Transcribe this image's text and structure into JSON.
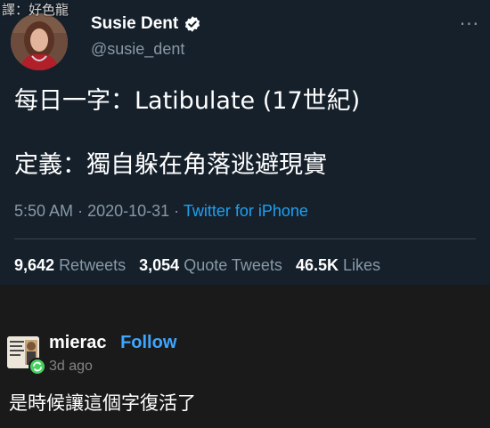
{
  "watermark": "譯：好色龍",
  "tweet": {
    "author_name": "Susie Dent",
    "handle": "@susie_dent",
    "line1": "每日一字：Latibulate (17世紀)",
    "line2": "定義：獨自躲在角落逃避現實",
    "time": "5:50 AM",
    "date": "2020-10-31",
    "separator": "·",
    "source": "Twitter for iPhone",
    "stats": {
      "retweets_count": "9,642",
      "retweets_label": "Retweets",
      "quotes_count": "3,054",
      "quotes_label": "Quote Tweets",
      "likes_count": "46.5K",
      "likes_label": "Likes"
    },
    "icons": {
      "verified": "verified-badge-icon",
      "more": "more-options-icon"
    },
    "colors": {
      "background": "#15202b",
      "link": "#1da1f2",
      "muted": "#8899a6"
    }
  },
  "comment": {
    "username": "mierac",
    "follow_label": "Follow",
    "time_ago": "3d ago",
    "text": "是時候讓這個字復活了",
    "colors": {
      "background": "#1a1a1b",
      "follow": "#3ea6ff"
    }
  }
}
